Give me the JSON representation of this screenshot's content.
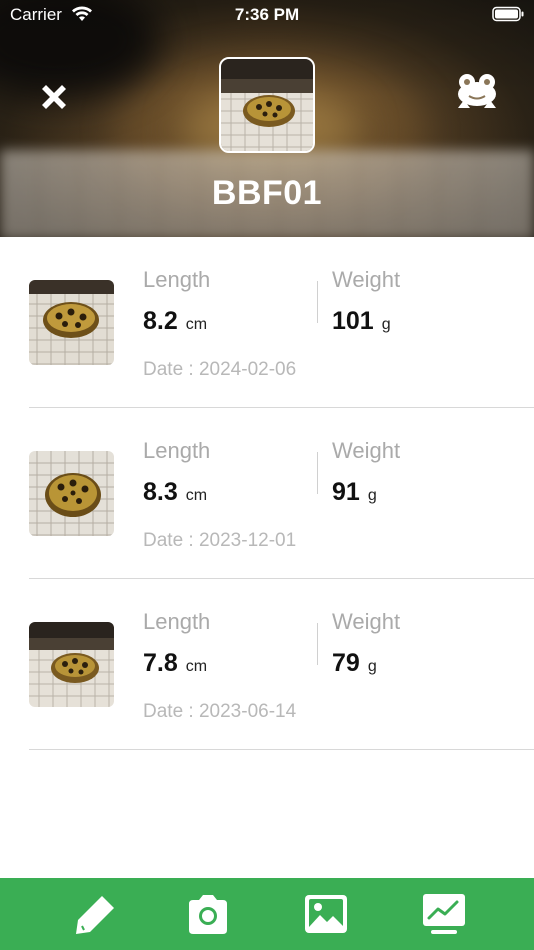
{
  "status_bar": {
    "carrier": "Carrier",
    "time": "7:36 PM"
  },
  "header": {
    "title": "BBF01"
  },
  "records": [
    {
      "length_label": "Length",
      "length_value": "8.2",
      "length_unit": "cm",
      "weight_label": "Weight",
      "weight_value": "101",
      "weight_unit": "g",
      "date": "Date : 2024-02-06"
    },
    {
      "length_label": "Length",
      "length_value": "8.3",
      "length_unit": "cm",
      "weight_label": "Weight",
      "weight_value": "91",
      "weight_unit": "g",
      "date": "Date : 2023-12-01"
    },
    {
      "length_label": "Length",
      "length_value": "7.8",
      "length_unit": "cm",
      "weight_label": "Weight",
      "weight_value": "79",
      "weight_unit": "g",
      "date": "Date : 2023-06-14"
    }
  ],
  "tab_bar": {
    "icons": [
      "pencil-icon",
      "camera-icon",
      "image-icon",
      "chart-icon"
    ],
    "color": "#3aae54"
  }
}
